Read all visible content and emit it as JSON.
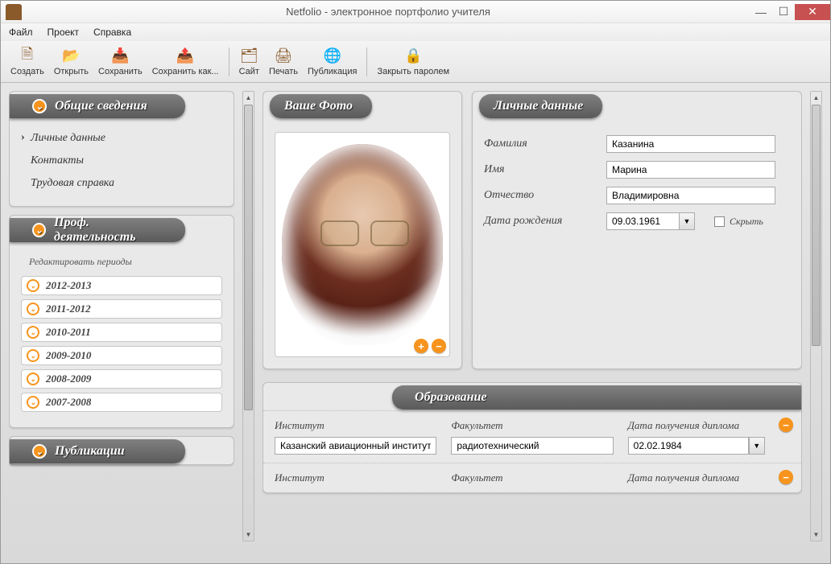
{
  "window": {
    "title": "Netfolio - электронное портфолио учителя"
  },
  "menu": [
    "Файл",
    "Проект",
    "Справка"
  ],
  "toolbar": {
    "create": "Создать",
    "open": "Открыть",
    "save": "Сохранить",
    "saveas": "Сохранить как...",
    "site": "Сайт",
    "print": "Печать",
    "publish": "Публикация",
    "lock": "Закрыть паролем"
  },
  "sidebar": {
    "general": {
      "title": "Общие сведения",
      "items": [
        "Личные данные",
        "Контакты",
        "Трудовая справка"
      ]
    },
    "prof": {
      "title": "Проф. деятельность",
      "edit": "Редактировать периоды",
      "periods": [
        "2012-2013",
        "2011-2012",
        "2010-2011",
        "2009-2010",
        "2008-2009",
        "2007-2008"
      ]
    },
    "pub": {
      "title": "Публикации"
    }
  },
  "photo": {
    "title": "Ваше Фото"
  },
  "personal": {
    "title": "Личные данные",
    "lastname_l": "Фамилия",
    "lastname": "Казанина",
    "firstname_l": "Имя",
    "firstname": "Марина",
    "patronymic_l": "Отчество",
    "patronymic": "Владимировна",
    "dob_l": "Дата рождения",
    "dob": "09.03.1961",
    "hide": "Скрыть"
  },
  "education": {
    "title": "Образование",
    "cols": {
      "inst": "Институт",
      "fac": "Факультет",
      "date": "Дата получения диплома"
    },
    "rows": [
      {
        "inst": "Казанский авиационный институт",
        "fac": "радиотехнический",
        "date": "02.02.1984"
      },
      {
        "inst": "",
        "fac": "",
        "date": ""
      }
    ]
  }
}
